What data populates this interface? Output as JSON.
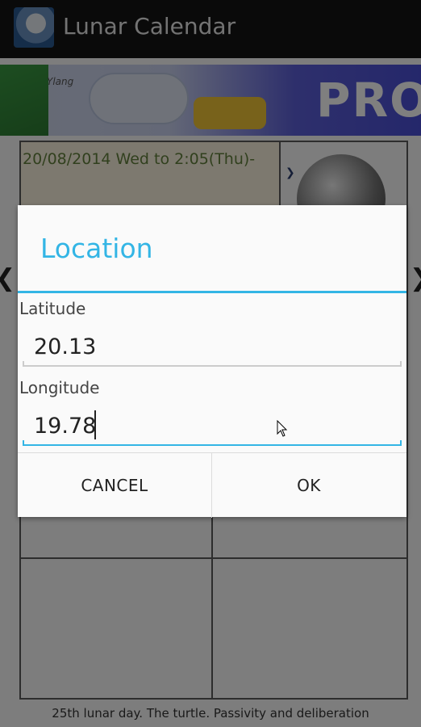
{
  "app": {
    "title": "Lunar Calendar"
  },
  "banner": {
    "tag": "Ylang",
    "label": "PRO"
  },
  "calendar": {
    "date_text": "20/08/2014 Wed to 2:05(Thu)-",
    "caption": "25th lunar day. The turtle. Passivity and deliberation"
  },
  "dialog": {
    "title": "Location",
    "latitude": {
      "label": "Latitude",
      "value": "20.13"
    },
    "longitude": {
      "label": "Longitude",
      "value": "19.78"
    },
    "cancel_label": "CANCEL",
    "ok_label": "OK"
  },
  "colors": {
    "accent": "#33b5e5",
    "date_text": "#63803d",
    "actionbar": "#141414"
  }
}
